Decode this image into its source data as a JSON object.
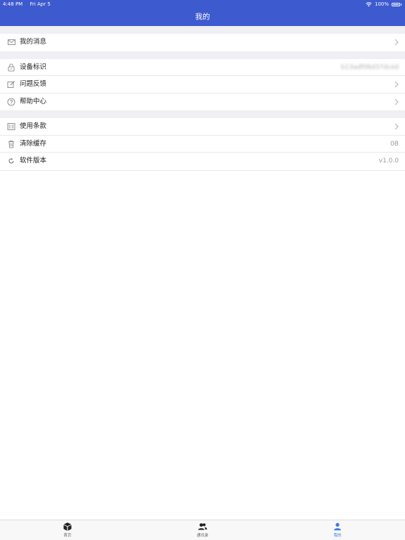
{
  "status_bar": {
    "time": "4:48 PM",
    "date": "Fri Apr 5",
    "battery": "100%"
  },
  "header": {
    "title": "我的"
  },
  "menu": {
    "messages": {
      "label": "我的消息",
      "icon": "envelope-icon"
    },
    "device_id": {
      "label": "设备标识",
      "value": "b13adf06d37dced",
      "icon": "lock-icon"
    },
    "feedback": {
      "label": "问题反馈",
      "icon": "edit-icon"
    },
    "help": {
      "label": "帮助中心",
      "icon": "question-icon"
    },
    "terms": {
      "label": "使用条款",
      "icon": "document-icon"
    },
    "cache": {
      "label": "清除缓存",
      "value": "0B",
      "icon": "trash-icon"
    },
    "version": {
      "label": "软件版本",
      "value": "v1.0.0",
      "icon": "refresh-icon"
    }
  },
  "tabbar": {
    "tabs": [
      {
        "label": "首页",
        "icon": "cube-icon"
      },
      {
        "label": "通讯录",
        "icon": "contacts-icon"
      },
      {
        "label": "我的",
        "icon": "person-icon",
        "active": true
      }
    ]
  },
  "colors": {
    "accent": "#3d5acf",
    "active_tab": "#3d7be0",
    "background": "#efeff4"
  }
}
